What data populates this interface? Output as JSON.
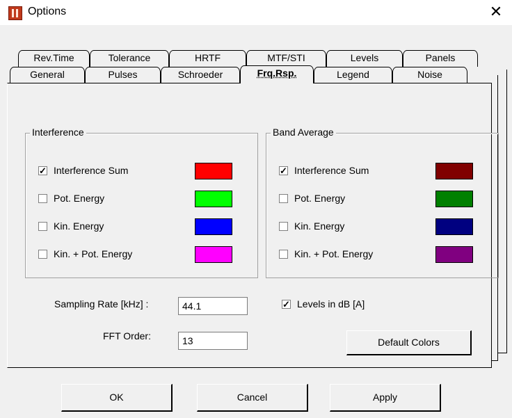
{
  "window": {
    "title": "Options",
    "close_glyph": "✕"
  },
  "tabs": {
    "back_row": [
      "Rev.Time",
      "Tolerance",
      "HRTF",
      "MTF/STI",
      "Levels",
      "Panels"
    ],
    "front_row": [
      "General",
      "Pulses",
      "Schroeder",
      "Frq.Rsp.",
      "Legend",
      "Noise"
    ],
    "active": "Frq.Rsp."
  },
  "interference": {
    "title": "Interference",
    "items": [
      {
        "label": "Interference Sum",
        "checked": true,
        "color": "#ff0000"
      },
      {
        "label": "Pot. Energy",
        "checked": false,
        "color": "#00ff00"
      },
      {
        "label": "Kin. Energy",
        "checked": false,
        "color": "#0000ff"
      },
      {
        "label": "Kin. + Pot. Energy",
        "checked": false,
        "color": "#ff00ff"
      }
    ]
  },
  "band_average": {
    "title": "Band Average",
    "items": [
      {
        "label": "Interference Sum",
        "checked": true,
        "color": "#800000"
      },
      {
        "label": "Pot. Energy",
        "checked": false,
        "color": "#008000"
      },
      {
        "label": "Kin. Energy",
        "checked": false,
        "color": "#000080"
      },
      {
        "label": "Kin. + Pot. Energy",
        "checked": false,
        "color": "#800080"
      }
    ]
  },
  "sampling": {
    "label": "Sampling Rate [kHz] :",
    "value": "44.1"
  },
  "fft": {
    "label": "FFT Order:",
    "value": "13"
  },
  "levels_db": {
    "label": "Levels in dB [A]",
    "checked": true
  },
  "buttons": {
    "default_colors": "Default Colors",
    "ok": "OK",
    "cancel": "Cancel",
    "apply": "Apply"
  }
}
